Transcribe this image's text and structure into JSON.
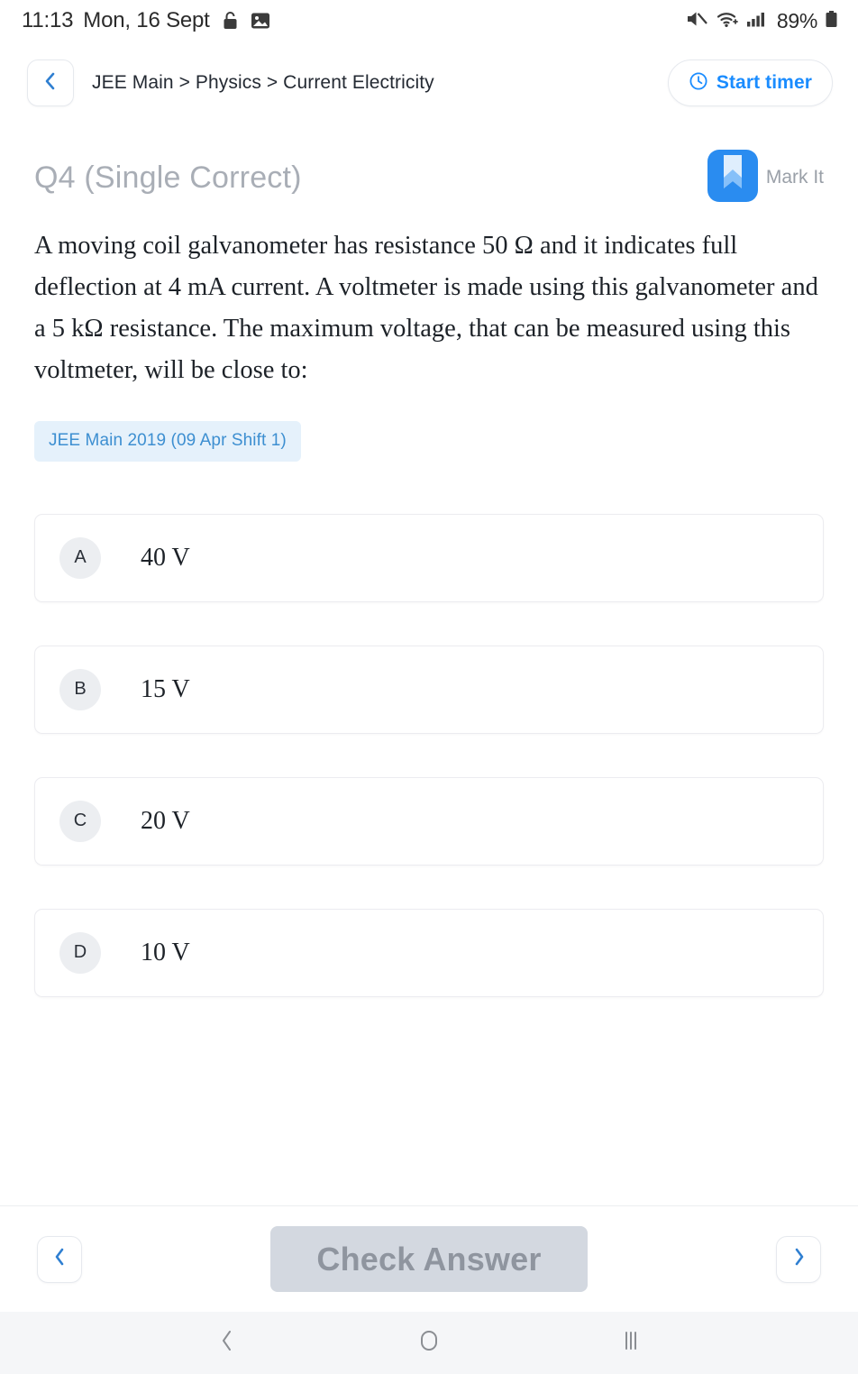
{
  "status_bar": {
    "time": "11:13",
    "date": "Mon, 16 Sept",
    "left_icons": [
      "lock-icon",
      "photo-icon"
    ],
    "right_icons": [
      "mute-icon",
      "wifi-icon",
      "cellular-signal-icon"
    ],
    "battery": "89%"
  },
  "header": {
    "back_icon": "chevron-left-icon",
    "breadcrumb": "JEE Main > Physics > Current Electricity",
    "timer_button": {
      "label": "Start timer",
      "icon": "clock-icon",
      "color": "#1a8cff"
    }
  },
  "question": {
    "title": "Q4 (Single Correct)",
    "mark_it": {
      "label": "Mark It",
      "icon": "bookmark-icon",
      "color": "#2a8cf0"
    },
    "text_parts": [
      "A moving coil galvanometer has resistance 50 Ω and it indicates full deflection at 4 mA current. A voltmeter is made using this galvanometer and a 5 kΩ resistance. The maximum voltage, that can be measured using this voltmeter, will be close to:"
    ],
    "text": "A moving coil galvanometer has resistance 50 Ω and it indicates full deflection at 4 mA current. A voltmeter is made using this galvanometer and a 5 kΩ resistance. The maximum voltage, that can be measured using this voltmeter, will be close to:",
    "tag": "JEE Main 2019 (09 Apr Shift 1)",
    "tag_colors": {
      "background": "#e5f1fb",
      "text": "#3d8fd1"
    }
  },
  "options": [
    {
      "key": "A",
      "value": "40 V"
    },
    {
      "key": "B",
      "value": "15 V"
    },
    {
      "key": "C",
      "value": "20 V"
    },
    {
      "key": "D",
      "value": "10 V"
    }
  ],
  "bottom_bar": {
    "prev_icon": "chevron-left-icon",
    "next_icon": "chevron-right-icon",
    "check_label": "Check Answer",
    "check_disabled": true,
    "check_colors": {
      "background": "#d3d8e0",
      "text": "#8f959f"
    }
  },
  "android_nav": {
    "back_icon": "nav-back-icon",
    "home_icon": "nav-home-icon",
    "recents_icon": "nav-recents-icon"
  }
}
